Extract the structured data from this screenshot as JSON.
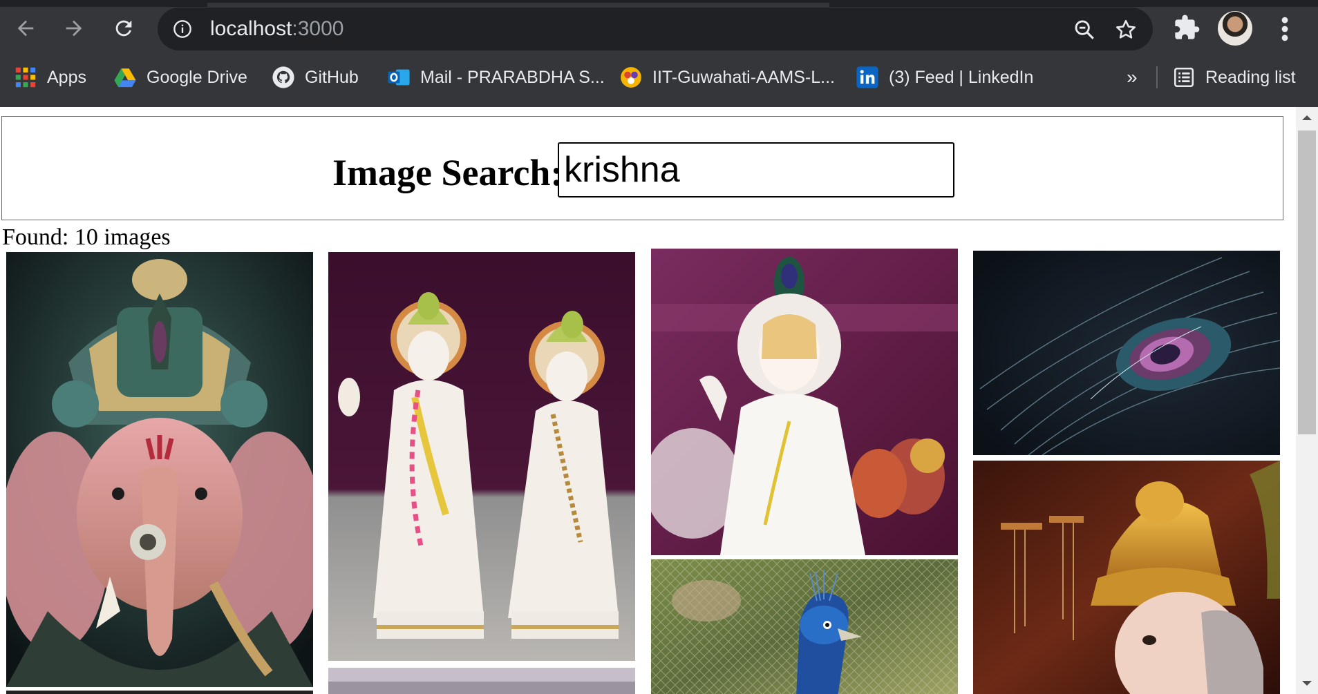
{
  "browser": {
    "url_host": "localhost",
    "url_port": ":3000",
    "bookmarks": [
      {
        "label": "Apps",
        "icon": "apps-grid-icon"
      },
      {
        "label": "Google Drive",
        "icon": "google-drive-icon"
      },
      {
        "label": "GitHub",
        "icon": "github-icon"
      },
      {
        "label": "Mail - PRARABDHA S...",
        "icon": "outlook-icon"
      },
      {
        "label": "IIT-Guwahati-AAMS-L...",
        "icon": "aams-icon"
      },
      {
        "label": "(3) Feed | LinkedIn",
        "icon": "linkedin-icon"
      }
    ],
    "overflow_label": "»",
    "reading_list_label": "Reading list"
  },
  "search": {
    "label": "Image Search:",
    "value": "krishna"
  },
  "results": {
    "found_text": "Found: 10 images",
    "images": [
      {
        "subject": "Ganesha idol with ornate crown"
      },
      {
        "subject": "White marble Radha Krishna statues"
      },
      {
        "subject": "White marble Krishna statue with peacock feather"
      },
      {
        "subject": "Close-up peacock feather eye"
      },
      {
        "subject": "Ganesha idol with golden crown"
      },
      {
        "subject": "Peacock head with crest"
      },
      {
        "subject": "Partially visible image"
      },
      {
        "subject": "Partially visible image"
      }
    ]
  },
  "colors": {
    "chrome_bg": "#35363a",
    "omnibox_bg": "#202124",
    "chrome_text": "#e8eaed"
  }
}
